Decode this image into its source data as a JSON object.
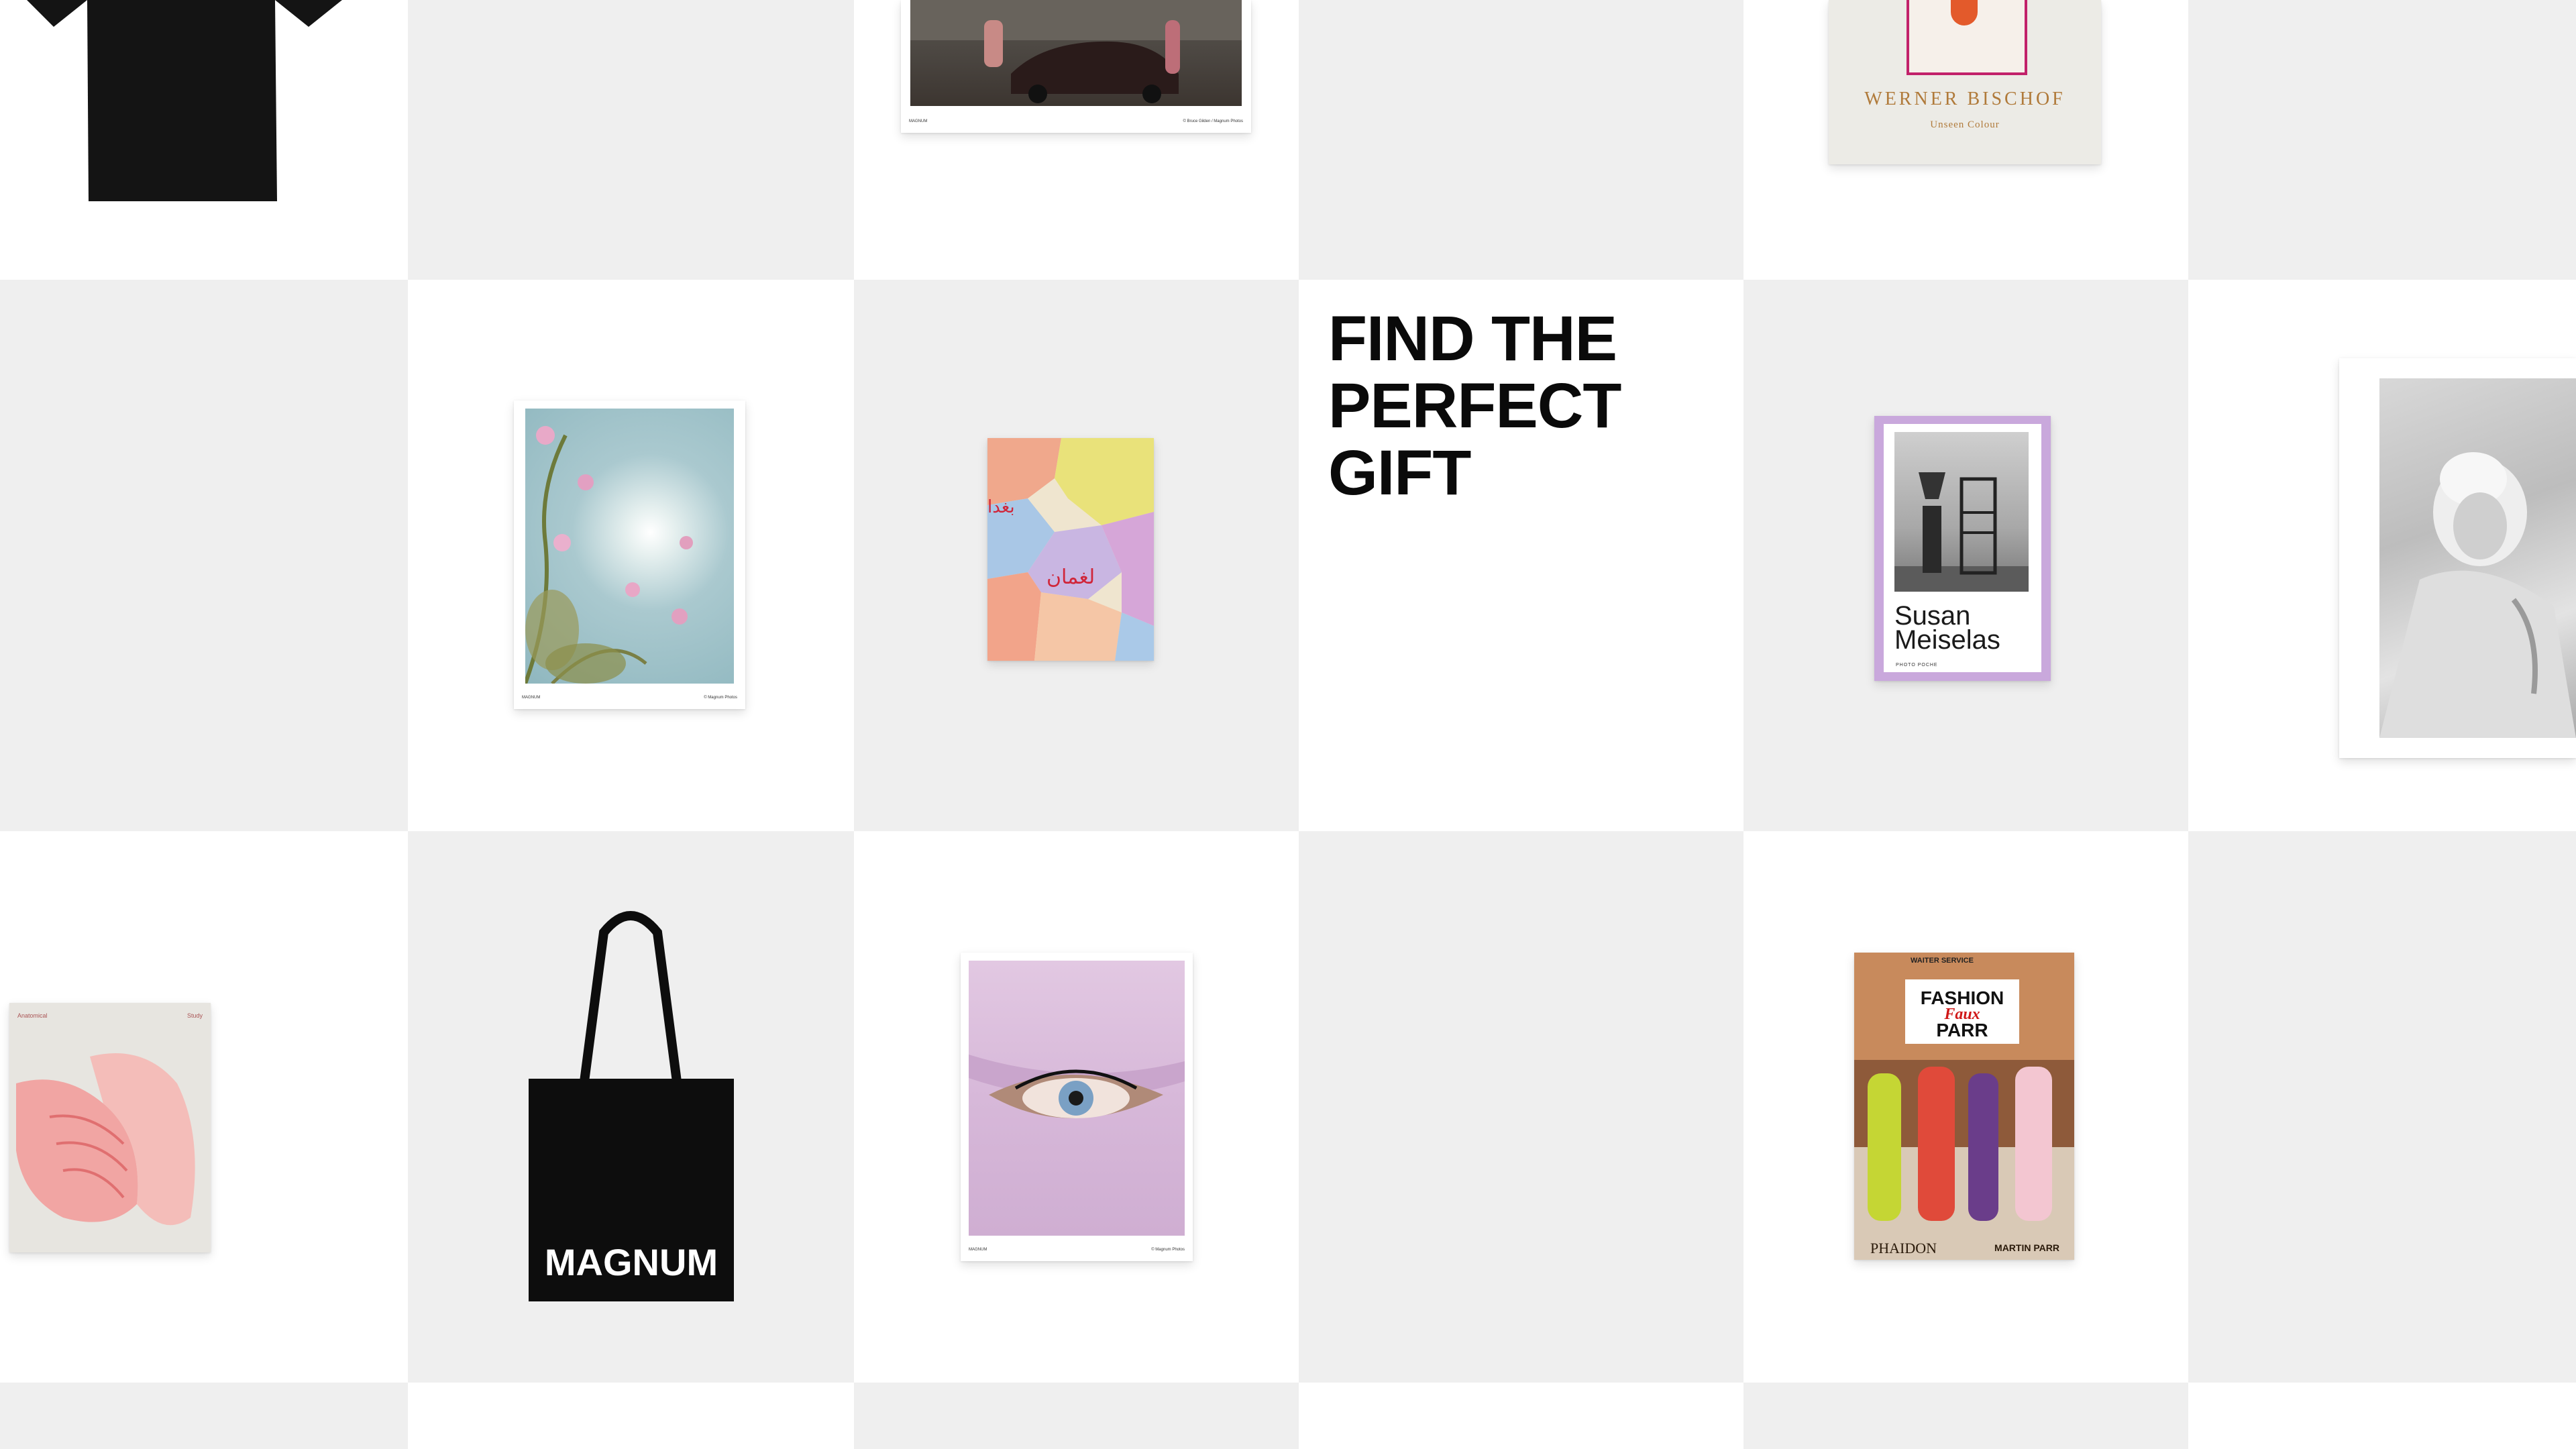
{
  "hero": {
    "title_line1": "FIND THE",
    "title_line2": "PERFECT",
    "title_line3": "GIFT"
  },
  "products": {
    "tshirt": {
      "name": "tshirt",
      "color": "#141414"
    },
    "poster_car": {
      "brand_text": "MAGNUM",
      "photo_credit": "© Bruce Gilden / Magnum Photos"
    },
    "bischof_book": {
      "author": "WERNER BISCHOF",
      "subtitle": "Unseen Colour",
      "accent_color": "#b07a3a"
    },
    "poster_flowers": {
      "brand_text": "MAGNUM",
      "photo_credit": "© Magnum Photos"
    },
    "map_print": {
      "arabic_text_1": "لغمان",
      "arabic_text_2": "بغدا"
    },
    "meiselas_book": {
      "author": "Susan Meiselas",
      "series": "PHOTO POCHE",
      "cover_color": "#c9a8dc"
    },
    "monroe_print": {
      "name": "portrait-print"
    },
    "hands_book": {
      "author_text": "Anatomical",
      "title_text": "Study"
    },
    "tote_bag": {
      "label": "MAGNUM",
      "color": "#0d0d0d"
    },
    "poster_eye": {
      "brand_text": "MAGNUM",
      "photo_credit": "© Magnum Photos"
    },
    "parr_book": {
      "sign_text": "WAITER SERVICE",
      "line1": "FASHION",
      "line2": "Faux",
      "line3": "PARR",
      "publisher": "PHAIDON",
      "author": "MARTIN PARR"
    }
  },
  "colors": {
    "tile_white": "#ffffff",
    "tile_grey": "#efefef",
    "headline": "#0a0a0a"
  }
}
